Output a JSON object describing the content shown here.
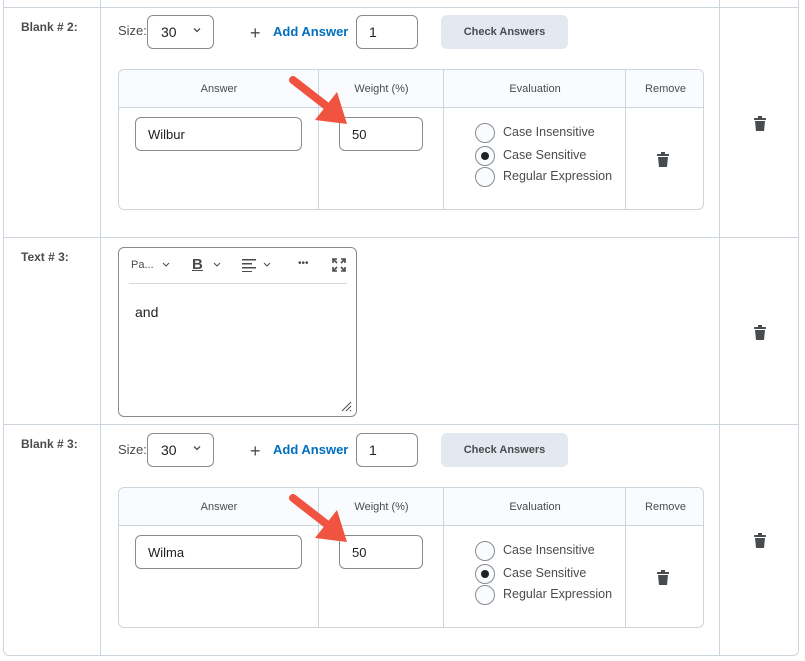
{
  "rows": [
    {
      "type": "blank",
      "label": "Blank # 2:",
      "size_label": "Size:",
      "size_value": "30",
      "add_answer_label": "Add Answer",
      "add_answer_count": "1",
      "check_answers_label": "Check Answers",
      "columns": [
        "Answer",
        "Weight (%)",
        "Evaluation",
        "Remove"
      ],
      "answer": "Wilbur",
      "weight": "50",
      "evaluation_options": [
        "Case Insensitive",
        "Case Sensitive",
        "Regular Expression"
      ],
      "evaluation_selected": "Case Sensitive"
    },
    {
      "type": "text",
      "label": "Text # 3:",
      "toolbar": {
        "format_label": "Pa...",
        "bold_label": "B",
        "more_label": "•••"
      },
      "content": "and"
    },
    {
      "type": "blank",
      "label": "Blank # 3:",
      "size_label": "Size:",
      "size_value": "30",
      "add_answer_label": "Add Answer",
      "add_answer_count": "1",
      "check_answers_label": "Check Answers",
      "columns": [
        "Answer",
        "Weight (%)",
        "Evaluation",
        "Remove"
      ],
      "answer": "Wilma",
      "weight": "50",
      "evaluation_options": [
        "Case Insensitive",
        "Case Sensitive",
        "Regular Expression"
      ],
      "evaluation_selected": "Case Sensitive"
    }
  ],
  "colors": {
    "link": "#006fbf",
    "border": "#cdd5dc",
    "button_bg": "#e3e9f1",
    "annotation_arrow": "#f0533f"
  },
  "icons": {
    "plus": "+",
    "trash": "trash-icon",
    "chevron": "chevron-down-icon",
    "fullscreen": "fullscreen-icon",
    "align": "align-left-icon",
    "resize": "resize-handle-icon"
  }
}
